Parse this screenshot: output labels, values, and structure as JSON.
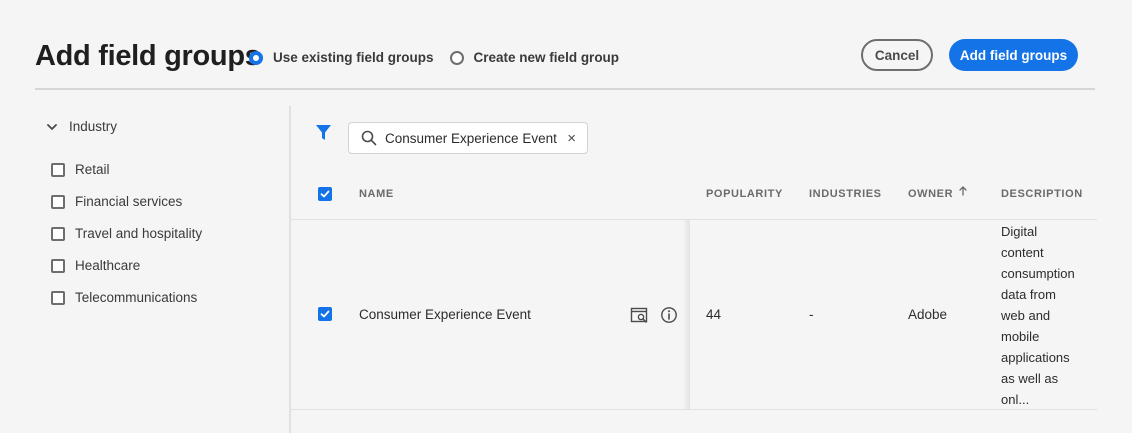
{
  "header": {
    "title": "Add field groups",
    "mode_options": [
      {
        "label": "Use existing field groups",
        "selected": true
      },
      {
        "label": "Create new field group",
        "selected": false
      }
    ],
    "cancel_label": "Cancel",
    "add_label": "Add field groups"
  },
  "sidebar": {
    "facet_title": "Industry",
    "items": [
      {
        "label": "Retail",
        "checked": false
      },
      {
        "label": "Financial services",
        "checked": false
      },
      {
        "label": "Travel and hospitality",
        "checked": false
      },
      {
        "label": "Healthcare",
        "checked": false
      },
      {
        "label": "Telecommunications",
        "checked": false
      }
    ]
  },
  "search": {
    "value": "Consumer Experience Event",
    "clear_glyph": "×"
  },
  "table": {
    "columns": [
      "NAME",
      "POPULARITY",
      "INDUSTRIES",
      "OWNER",
      "DESCRIPTION"
    ],
    "sorted_column": "OWNER",
    "sort_direction": "ascending",
    "select_all_checked": true,
    "rows": [
      {
        "checked": true,
        "name": "Consumer Experience Event",
        "popularity": "44",
        "industries": "-",
        "owner": "Adobe",
        "description": [
          "Digital",
          "content",
          "consumption",
          "data from",
          "web and",
          "mobile",
          "applications",
          "as well as",
          "onl..."
        ]
      }
    ]
  },
  "colors": {
    "accent": "#1473e6",
    "background": "#f5f5f5",
    "border": "#e1e1e1"
  },
  "icons": [
    "chevron-down-icon",
    "filter-icon",
    "search-icon",
    "close-icon",
    "preview-icon",
    "info-icon",
    "sort-arrow-up-icon",
    "checkmark-icon"
  ]
}
